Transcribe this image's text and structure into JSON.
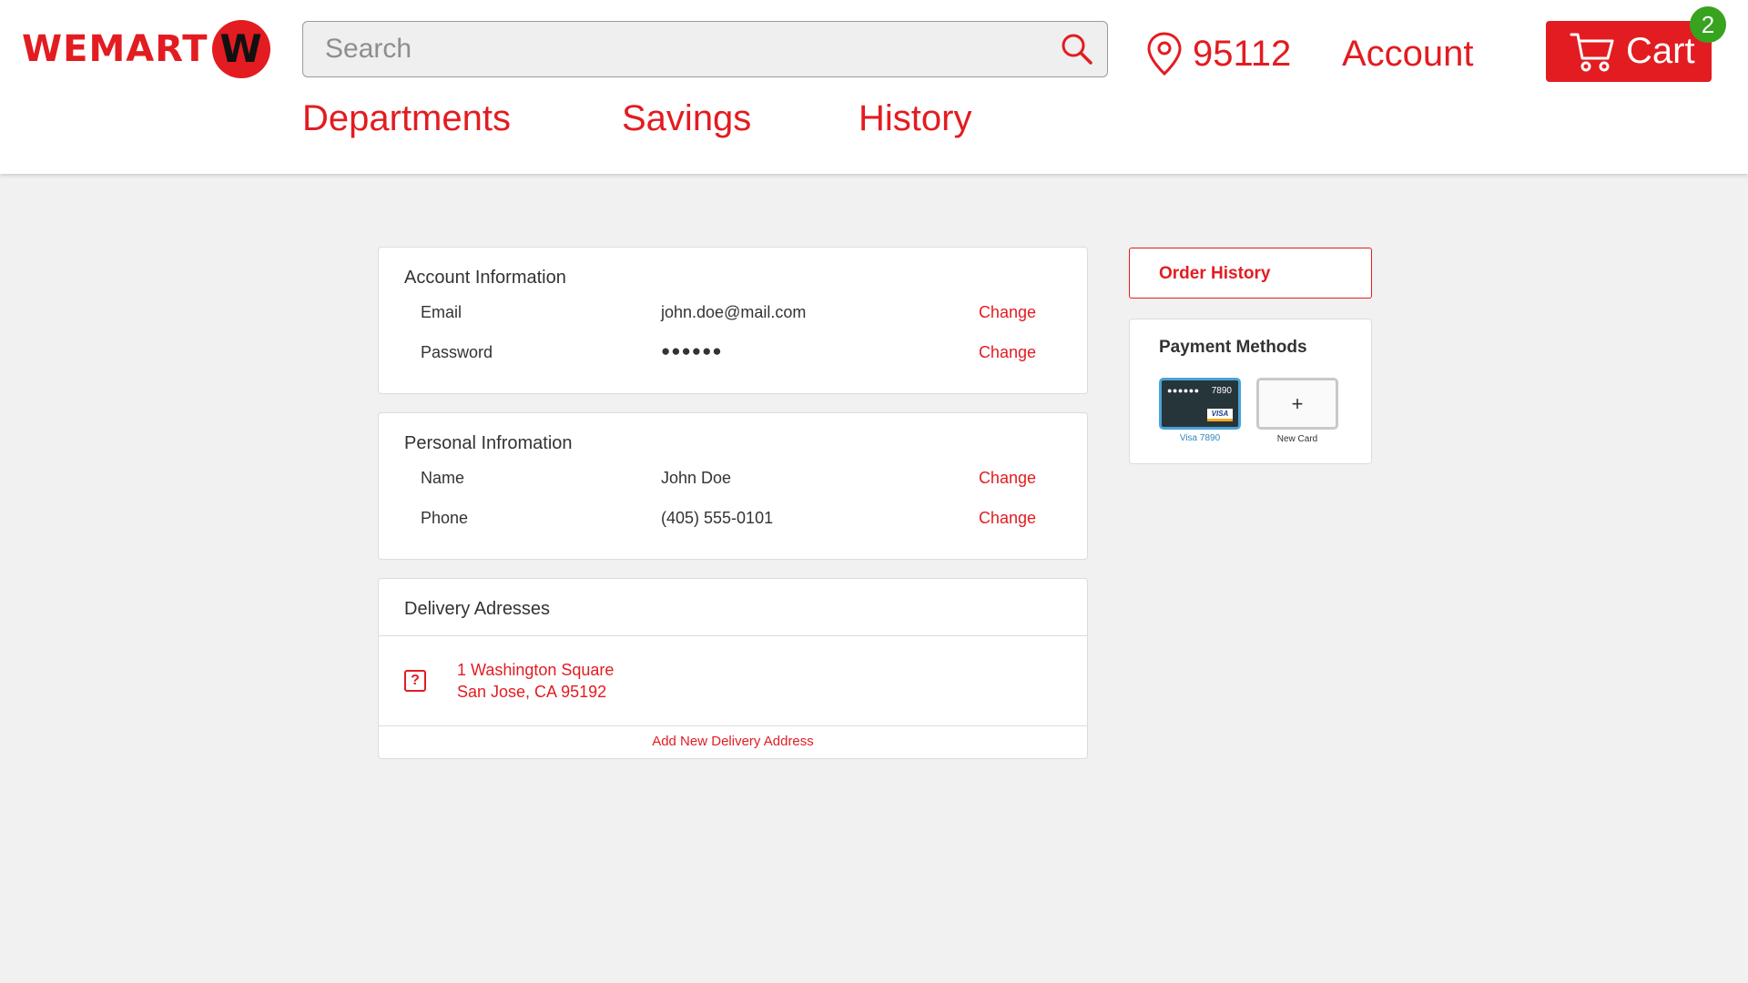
{
  "brand": {
    "name": "WEMART",
    "badge_letter": "W",
    "primary_color": "#e21c21"
  },
  "header": {
    "search_placeholder": "Search",
    "location_zip": "95112",
    "account_label": "Account",
    "cart_label": "Cart",
    "cart_count": "2"
  },
  "nav": {
    "items": [
      "Departments",
      "Savings",
      "History"
    ]
  },
  "account_info": {
    "title": "Account Information",
    "rows": [
      {
        "label": "Email",
        "value": "john.doe@mail.com",
        "action": "Change"
      },
      {
        "label": "Password",
        "value": "●●●●●●",
        "action": "Change"
      }
    ]
  },
  "personal_info": {
    "title": "Personal Infromation",
    "rows": [
      {
        "label": "Name",
        "value": "John Doe",
        "action": "Change"
      },
      {
        "label": "Phone",
        "value": "(405) 555-0101",
        "action": "Change"
      }
    ]
  },
  "delivery": {
    "title": "Delivery Adresses",
    "icon_glyph": "?",
    "address_line1": "1 Washington Square",
    "address_line2": "San Jose, CA 95192",
    "add_label": "Add New Delivery Address"
  },
  "sidebar": {
    "order_history_label": "Order History",
    "payment_title": "Payment Methods",
    "card": {
      "masked": "●●●●●●",
      "last4": "7890",
      "brand": "VISA",
      "caption": "Visa 7890"
    },
    "new_card": {
      "glyph": "+",
      "caption": "New Card"
    }
  }
}
